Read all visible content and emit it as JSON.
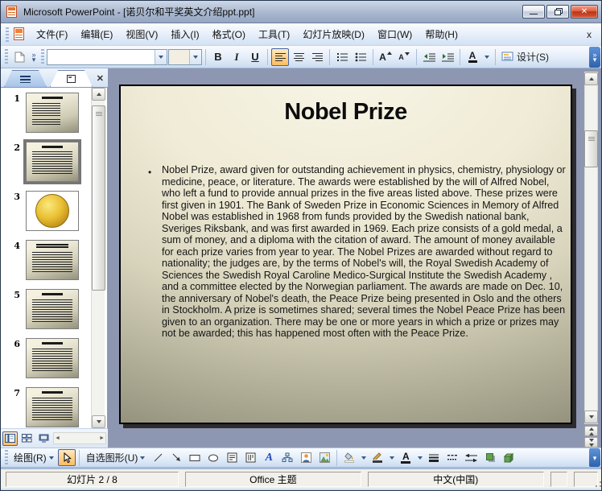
{
  "window": {
    "title": "Microsoft PowerPoint - [诺贝尔和平奖英文介绍ppt.ppt]"
  },
  "glyphs": {
    "minimize": "—",
    "close": "✕",
    "menu_close": "x",
    "overflow": "»",
    "overflow_down": "▾",
    "scroll_left": "◄",
    "scroll_right": "►"
  },
  "menu": {
    "items": [
      "文件(F)",
      "编辑(E)",
      "视图(V)",
      "插入(I)",
      "格式(O)",
      "工具(T)",
      "幻灯片放映(D)",
      "窗口(W)",
      "帮助(H)"
    ]
  },
  "format_toolbar": {
    "bold": "B",
    "italic": "I",
    "underline": "U",
    "grow_font": "A",
    "shrink_font": "A",
    "font_color": "A",
    "design": "设计(S)",
    "font_value": "",
    "size_value": ""
  },
  "slides_panel": {
    "slides": [
      {
        "n": "1"
      },
      {
        "n": "2"
      },
      {
        "n": "3"
      },
      {
        "n": "4"
      },
      {
        "n": "5"
      },
      {
        "n": "6"
      },
      {
        "n": "7"
      }
    ],
    "selected_slide": "2"
  },
  "slide": {
    "title": "Nobel Prize",
    "bullet": "•",
    "body": "Nobel Prize, award given for outstanding achievement in physics, chemistry, physiology or medicine, peace, or literature. The awards were established by the will of Alfred Nobel, who left a fund to provide annual prizes in the five areas listed above. These prizes were first given in 1901. The Bank of Sweden Prize in Economic Sciences in Memory of Alfred Nobel was established in 1968 from funds provided by the Swedish national bank, Sveriges Riksbank, and was first awarded in 1969. Each prize consists of a gold medal, a sum of money, and a diploma with the citation of award. The amount of money available for each prize varies from year to year. The Nobel Prizes are awarded without regard to nationality; the judges are, by the terms of Nobel's will, the Royal Swedish Academy of Sciences the Swedish Royal Caroline Medico-Surgical Institute the Swedish Academy , and a committee elected by the Norwegian parliament. The awards are made on Dec. 10, the anniversary of Nobel's death, the Peace Prize being presented in Oslo and the others in Stockholm. A prize is sometimes shared; several times the Nobel Peace Prize has been given to an organization. There may be one or more years in which a prize or prizes may not be awarded; this has happened most often with the Peace Prize."
  },
  "drawing_toolbar": {
    "draw": "绘图(R)",
    "autoshapes": "自选图形(U)",
    "wordart": "A",
    "font_color": "A"
  },
  "status_bar": {
    "slide_indicator": "幻灯片 2 / 8",
    "theme": "Office 主题",
    "language": "中文(中国)"
  },
  "colors": {
    "toolbar_selected": "#fdbd62",
    "slide_bg_light": "#f8f5e6",
    "slide_bg_dark": "#7c7a67",
    "close_button_red": "#bf3315",
    "main_background": "#8e97b1"
  }
}
